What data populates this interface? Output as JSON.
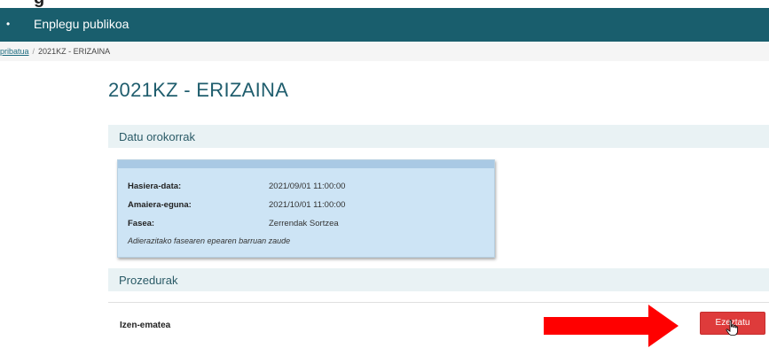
{
  "header": {
    "app_title": "Enplegu publikoa",
    "cropped_heading": "g"
  },
  "breadcrumb": {
    "parent": "pribatua",
    "separator": "/",
    "current": "2021KZ - ERIZAINA"
  },
  "page": {
    "title": "2021KZ - ERIZAINA"
  },
  "general_section": {
    "title": "Datu orokorrak",
    "rows": [
      {
        "label": "Hasiera-data:",
        "value": "2021/09/01 11:00:00"
      },
      {
        "label": "Amaiera-eguna:",
        "value": "2021/10/01 11:00:00"
      },
      {
        "label": "Fasea:",
        "value": "Zerrendak Sortzea"
      }
    ],
    "note": "Adierazitako fasearen epearen barruan zaude"
  },
  "procedures_section": {
    "title": "Prozedurak",
    "item_label": "Izen-ematea",
    "confirm_label": "Ezeztatu"
  },
  "colors": {
    "header_bg": "#195e6d",
    "button_bg": "#de3b3b",
    "arrow": "#ff0000",
    "info_bg": "#cde4f5"
  }
}
